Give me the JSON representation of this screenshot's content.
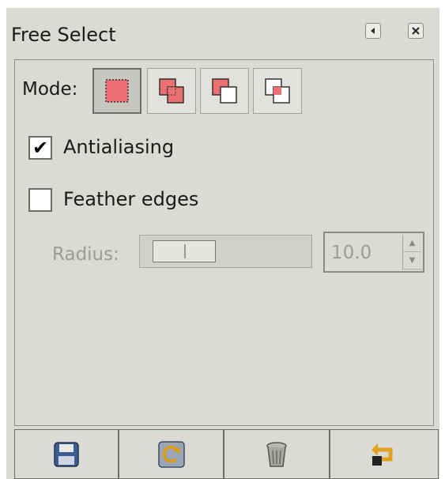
{
  "header": {
    "title": "Free Select",
    "buttons": [
      {
        "name": "collapse-button",
        "icon": "arrow-left-icon"
      },
      {
        "name": "close-button",
        "icon": "close-icon"
      }
    ]
  },
  "options": {
    "mode_label": "Mode:",
    "modes": [
      {
        "name": "replace",
        "icon": "replace-selection-icon",
        "active": true
      },
      {
        "name": "add",
        "icon": "add-selection-icon",
        "active": false
      },
      {
        "name": "subtract",
        "icon": "subtract-selection-icon",
        "active": false
      },
      {
        "name": "intersect",
        "icon": "intersect-selection-icon",
        "active": false
      }
    ],
    "antialiasing": {
      "label": "Antialiasing",
      "checked": true
    },
    "feather_edges": {
      "label": "Feather edges",
      "checked": false
    },
    "radius": {
      "label": "Radius:",
      "value": "10.0",
      "enabled": false
    }
  },
  "bottom_bar": {
    "buttons": [
      {
        "name": "save-options",
        "icon": "save-icon"
      },
      {
        "name": "restore-options",
        "icon": "restore-icon"
      },
      {
        "name": "delete-options",
        "icon": "trash-icon"
      },
      {
        "name": "reset-options",
        "icon": "reset-icon"
      }
    ]
  },
  "colors": {
    "background": "#dcdad5",
    "selection_fill": "#ec6f73",
    "icon_blue": "#3b5d8f"
  }
}
